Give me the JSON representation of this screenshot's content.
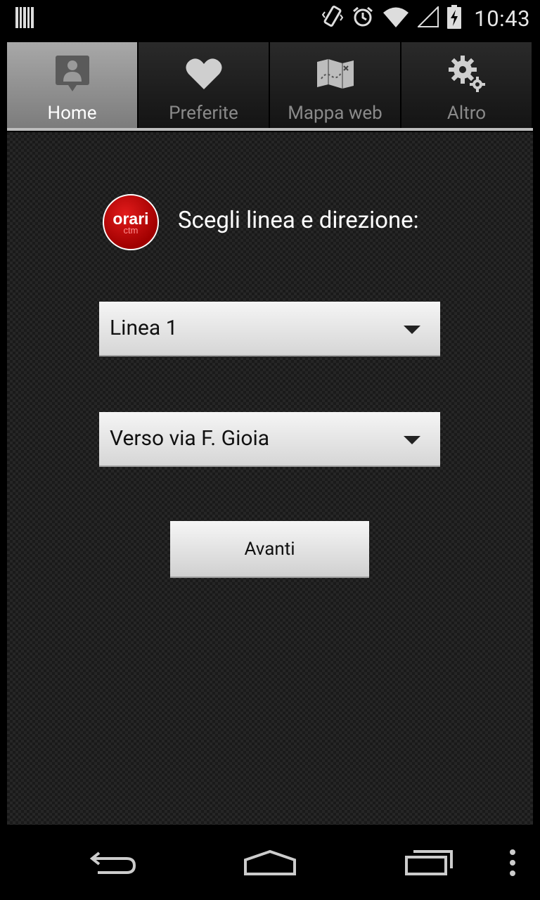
{
  "status_bar": {
    "time": "10:43",
    "icons": [
      "barcode-icon",
      "vibrate-icon",
      "alarm-icon",
      "wifi-icon",
      "signal-icon",
      "battery-charging-icon"
    ]
  },
  "tabs": [
    {
      "label": "Home",
      "icon": "person-pin-icon",
      "active": true
    },
    {
      "label": "Preferite",
      "icon": "heart-icon",
      "active": false
    },
    {
      "label": "Mappa web",
      "icon": "map-icon",
      "active": false
    },
    {
      "label": "Altro",
      "icon": "gears-icon",
      "active": false
    }
  ],
  "main": {
    "logo": {
      "text": "orari",
      "subtext": "ctm"
    },
    "title": "Scegli linea e direzione:",
    "line_select": {
      "value": "Linea 1"
    },
    "direction_select": {
      "value": "Verso via F. Gioia"
    },
    "next_button": {
      "label": "Avanti"
    }
  },
  "nav_bar": {
    "icons": [
      "back-icon",
      "home-icon",
      "recents-icon",
      "overflow-menu-icon"
    ]
  },
  "colors": {
    "logo_red": "#c40a0a",
    "active_tab": "#9a9a9a",
    "background": "#1a1a1a"
  }
}
